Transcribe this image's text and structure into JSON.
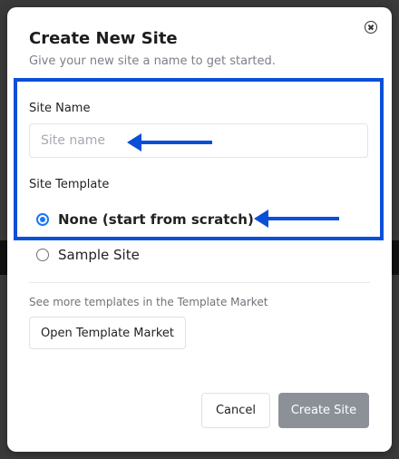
{
  "dialog": {
    "title": "Create New Site",
    "subtitle": "Give your new site a name to get started.",
    "close_icon": "close-circle-icon"
  },
  "site_name": {
    "label": "Site Name",
    "value": "",
    "placeholder": "Site name"
  },
  "site_template": {
    "label": "Site Template",
    "options": [
      {
        "label": "None (start from scratch)",
        "selected": true
      },
      {
        "label": "Sample Site",
        "selected": false
      }
    ]
  },
  "template_market": {
    "hint": "See more templates in the Template Market",
    "button_label": "Open Template Market"
  },
  "footer": {
    "cancel_label": "Cancel",
    "create_label": "Create Site"
  },
  "colors": {
    "annotation": "#0a4fd8",
    "radio_accent": "#1677ff",
    "disabled_button": "#8c9198"
  }
}
